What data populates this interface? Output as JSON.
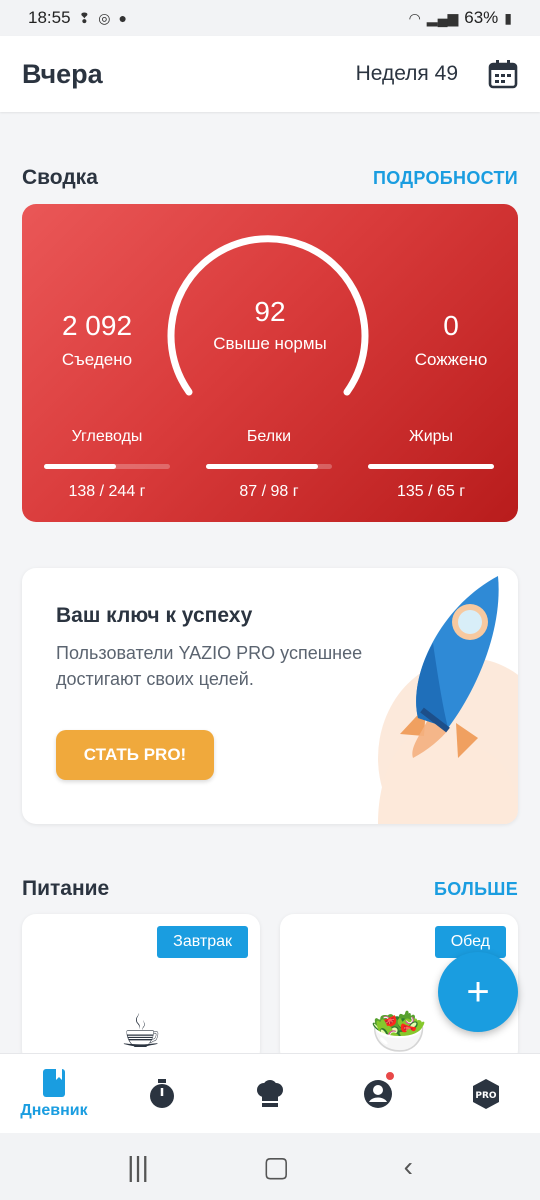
{
  "status_bar": {
    "time": "18:55",
    "battery": "63%"
  },
  "app_bar": {
    "title": "Вчера",
    "week": "Неделя 49"
  },
  "summary": {
    "heading": "Сводка",
    "link": "ПОДРОБНОСТИ",
    "eaten_value": "2 092",
    "eaten_label": "Съедено",
    "center_value": "92",
    "center_label": "Свыше нормы",
    "burned_value": "0",
    "burned_label": "Сожжено",
    "macros": [
      {
        "label": "Углеводы",
        "value": "138 / 244 г",
        "progress": 0.57
      },
      {
        "label": "Белки",
        "value": "87 / 98 г",
        "progress": 0.89
      },
      {
        "label": "Жиры",
        "value": "135 / 65 г",
        "progress": 1.0
      }
    ],
    "colors": {
      "card_start": "#ea5757",
      "card_end": "#b81c1c"
    }
  },
  "promo": {
    "heading": "Ваш ключ к успеху",
    "text": "Пользователи YAZIO PRO успешнее достигают своих целей.",
    "button": "СТАТЬ PRO!"
  },
  "nutrition": {
    "heading": "Питание",
    "link": "БОЛЬШЕ",
    "meals": [
      {
        "tag": "Завтрак",
        "icon": "☕"
      },
      {
        "tag": "Обед",
        "icon": "🥗"
      }
    ]
  },
  "fab": {
    "label": "+"
  },
  "bottom_nav": {
    "items": [
      {
        "label": "Дневник",
        "icon": "diary-icon"
      },
      {
        "label": "",
        "icon": "stopwatch-icon"
      },
      {
        "label": "",
        "icon": "chef-hat-icon"
      },
      {
        "label": "",
        "icon": "profile-icon"
      },
      {
        "label": "",
        "icon": "pro-icon",
        "badge_text": "PRO"
      }
    ]
  },
  "accent_color": "#1a9de0"
}
